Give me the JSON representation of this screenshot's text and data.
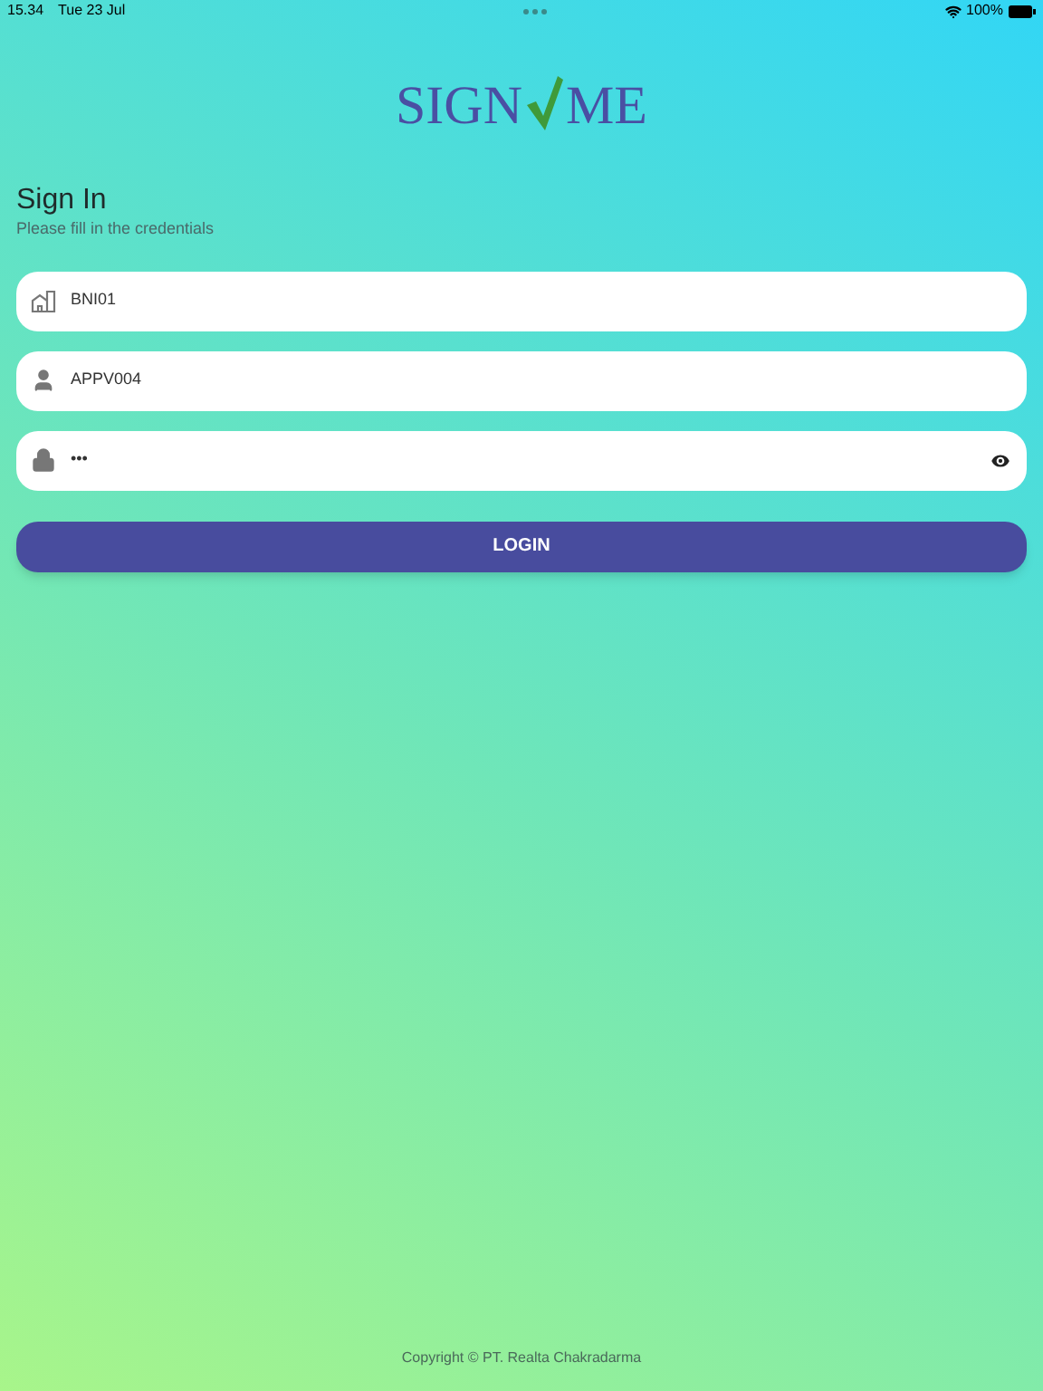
{
  "status_bar": {
    "time": "15.34",
    "date": "Tue 23 Jul",
    "battery": "100%"
  },
  "logo": {
    "left": "SIGN",
    "right": "ME"
  },
  "heading": {
    "title": "Sign In",
    "subtitle": "Please fill in the credentials"
  },
  "fields": [
    {
      "kind": "company",
      "value": "BNI01"
    },
    {
      "kind": "user",
      "value": "APPV004"
    },
    {
      "kind": "password",
      "value": "•••"
    }
  ],
  "login_button": "LOGIN",
  "footer": "Copyright © PT. Realta Chakradarma"
}
